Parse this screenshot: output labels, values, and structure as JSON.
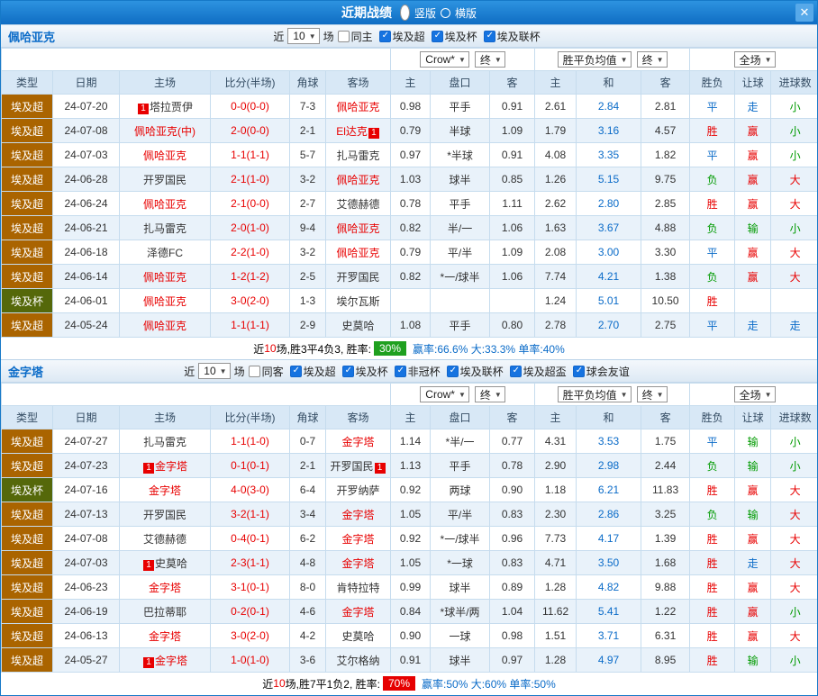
{
  "title_bar": {
    "title": "近期战绩",
    "vertical_label": "竖版",
    "horizontal_label": "横版",
    "close_label": "✕"
  },
  "filter_labels": {
    "near": "近",
    "games": "场"
  },
  "selects": {
    "bookmaker": "Crow*",
    "book_state": "终",
    "odds_mode": "胜平负均值",
    "odds_state": "终",
    "scope": "全场"
  },
  "table_columns": {
    "type": "类型",
    "date": "日期",
    "home": "主场",
    "score": "比分(半场)",
    "corner": "角球",
    "away": "客场",
    "asia_home": "主",
    "asia_handicap": "盘口",
    "asia_away": "客",
    "euro_home": "主",
    "euro_draw": "和",
    "euro_away": "客",
    "result": "胜负",
    "handicap": "让球",
    "goals": "进球数"
  },
  "colors": {
    "league_super_bg": "#aa6400",
    "league_cup_bg": "#55680a",
    "accent_red": "#e80000",
    "accent_green": "#009a00",
    "accent_blue": "#0a6bc8",
    "win_badge_green": "#1fa01f",
    "win_badge_red": "#e60000"
  },
  "sections": [
    {
      "team": "佩哈亚克",
      "near": "10",
      "filters": [
        {
          "label": "同主",
          "checked": false
        },
        {
          "label": "埃及超",
          "checked": true
        },
        {
          "label": "埃及杯",
          "checked": true
        },
        {
          "label": "埃及联杯",
          "checked": true
        }
      ],
      "rows": [
        {
          "lg": "埃及超",
          "cup": false,
          "date": "24-07-20",
          "h": "塔拉贾伊",
          "hr": false,
          "hb": "1",
          "hbp": "l",
          "a": "佩哈亚克",
          "ar": true,
          "s": "0-0(0-0)",
          "c": "7-3",
          "o1": "0.98",
          "o2": "平手",
          "o3": "0.91",
          "e1": "2.61",
          "e2": "2.84",
          "e3": "2.81",
          "w": "平",
          "wc": "b",
          "hd": "走",
          "hdc": "b",
          "g": "小",
          "gc": "g"
        },
        {
          "lg": "埃及超",
          "cup": false,
          "date": "24-07-08",
          "h": "佩哈亚克(中)",
          "hr": true,
          "a": "El达克",
          "ar": true,
          "ab": "1",
          "abp": "r",
          "s": "2-0(0-0)",
          "c": "2-1",
          "o1": "0.79",
          "o2": "半球",
          "o3": "1.09",
          "e1": "1.79",
          "e2": "3.16",
          "e3": "4.57",
          "w": "胜",
          "wc": "r",
          "hd": "赢",
          "hdc": "r",
          "g": "小",
          "gc": "g"
        },
        {
          "lg": "埃及超",
          "cup": false,
          "date": "24-07-03",
          "h": "佩哈亚克",
          "hr": true,
          "a": "扎马雷克",
          "ar": false,
          "s": "1-1(1-1)",
          "c": "5-7",
          "o1": "0.97",
          "o2": "*半球",
          "o3": "0.91",
          "e1": "4.08",
          "e2": "3.35",
          "e3": "1.82",
          "w": "平",
          "wc": "b",
          "hd": "赢",
          "hdc": "r",
          "g": "小",
          "gc": "g"
        },
        {
          "lg": "埃及超",
          "cup": false,
          "date": "24-06-28",
          "h": "开罗国民",
          "hr": false,
          "a": "佩哈亚克",
          "ar": true,
          "s": "2-1(1-0)",
          "c": "3-2",
          "o1": "1.03",
          "o2": "球半",
          "o3": "0.85",
          "e1": "1.26",
          "e2": "5.15",
          "e3": "9.75",
          "w": "负",
          "wc": "g",
          "hd": "赢",
          "hdc": "r",
          "g": "大",
          "gc": "r"
        },
        {
          "lg": "埃及超",
          "cup": false,
          "date": "24-06-24",
          "h": "佩哈亚克",
          "hr": true,
          "a": "艾德赫德",
          "ar": false,
          "s": "2-1(0-0)",
          "c": "2-7",
          "o1": "0.78",
          "o2": "平手",
          "o3": "1.11",
          "e1": "2.62",
          "e2": "2.80",
          "e3": "2.85",
          "w": "胜",
          "wc": "r",
          "hd": "赢",
          "hdc": "r",
          "g": "大",
          "gc": "r"
        },
        {
          "lg": "埃及超",
          "cup": false,
          "date": "24-06-21",
          "h": "扎马雷克",
          "hr": false,
          "a": "佩哈亚克",
          "ar": true,
          "s": "2-0(1-0)",
          "c": "9-4",
          "o1": "0.82",
          "o2": "半/一",
          "o3": "1.06",
          "e1": "1.63",
          "e2": "3.67",
          "e3": "4.88",
          "w": "负",
          "wc": "g",
          "hd": "输",
          "hdc": "g",
          "g": "小",
          "gc": "g"
        },
        {
          "lg": "埃及超",
          "cup": false,
          "date": "24-06-18",
          "h": "泽德FC",
          "hr": false,
          "a": "佩哈亚克",
          "ar": true,
          "s": "2-2(1-0)",
          "c": "3-2",
          "o1": "0.79",
          "o2": "平/半",
          "o3": "1.09",
          "e1": "2.08",
          "e2": "3.00",
          "e3": "3.30",
          "w": "平",
          "wc": "b",
          "hd": "赢",
          "hdc": "r",
          "g": "大",
          "gc": "r"
        },
        {
          "lg": "埃及超",
          "cup": false,
          "date": "24-06-14",
          "h": "佩哈亚克",
          "hr": true,
          "a": "开罗国民",
          "ar": false,
          "s": "1-2(1-2)",
          "c": "2-5",
          "o1": "0.82",
          "o2": "*一/球半",
          "o3": "1.06",
          "e1": "7.74",
          "e2": "4.21",
          "e3": "1.38",
          "w": "负",
          "wc": "g",
          "hd": "赢",
          "hdc": "r",
          "g": "大",
          "gc": "r"
        },
        {
          "lg": "埃及杯",
          "cup": true,
          "date": "24-06-01",
          "h": "佩哈亚克",
          "hr": true,
          "a": "埃尔瓦斯",
          "ar": false,
          "s": "3-0(2-0)",
          "c": "1-3",
          "o1": "",
          "o2": "",
          "o3": "",
          "e1": "1.24",
          "e2": "5.01",
          "e3": "10.50",
          "w": "胜",
          "wc": "r",
          "hd": "",
          "hdc": "",
          "g": "",
          "gc": ""
        },
        {
          "lg": "埃及超",
          "cup": false,
          "date": "24-05-24",
          "h": "佩哈亚克",
          "hr": true,
          "a": "史莫哈",
          "ar": false,
          "s": "1-1(1-1)",
          "c": "2-9",
          "o1": "1.08",
          "o2": "平手",
          "o3": "0.80",
          "e1": "2.78",
          "e2": "2.70",
          "e3": "2.75",
          "w": "平",
          "wc": "b",
          "hd": "走",
          "hdc": "b",
          "g": "走",
          "gc": "b"
        }
      ],
      "summary": {
        "pre": "近",
        "count": "10",
        "rest": "场,胜3平4负3, 胜率:",
        "pct": "30%",
        "pct_color": "#1fa01f",
        "stats": "赢率:66.6% 大:33.3% 单率:40%"
      }
    },
    {
      "team": "金字塔",
      "near": "10",
      "filters": [
        {
          "label": "同客",
          "checked": false
        },
        {
          "label": "埃及超",
          "checked": true
        },
        {
          "label": "埃及杯",
          "checked": true
        },
        {
          "label": "非冠杯",
          "checked": true
        },
        {
          "label": "埃及联杯",
          "checked": true
        },
        {
          "label": "埃及超盃",
          "checked": true
        },
        {
          "label": "球会友谊",
          "checked": true
        }
      ],
      "rows": [
        {
          "lg": "埃及超",
          "cup": false,
          "date": "24-07-27",
          "h": "扎马雷克",
          "hr": false,
          "a": "金字塔",
          "ar": true,
          "s": "1-1(1-0)",
          "c": "0-7",
          "o1": "1.14",
          "o2": "*半/一",
          "o3": "0.77",
          "e1": "4.31",
          "e2": "3.53",
          "e3": "1.75",
          "w": "平",
          "wc": "b",
          "hd": "输",
          "hdc": "g",
          "g": "小",
          "gc": "g"
        },
        {
          "lg": "埃及超",
          "cup": false,
          "date": "24-07-23",
          "h": "金字塔",
          "hr": true,
          "hb": "1",
          "hbp": "l",
          "a": "开罗国民",
          "ar": false,
          "ab": "1",
          "abp": "r",
          "s": "0-1(0-1)",
          "c": "2-1",
          "o1": "1.13",
          "o2": "平手",
          "o3": "0.78",
          "e1": "2.90",
          "e2": "2.98",
          "e3": "2.44",
          "w": "负",
          "wc": "g",
          "hd": "输",
          "hdc": "g",
          "g": "小",
          "gc": "g"
        },
        {
          "lg": "埃及杯",
          "cup": true,
          "date": "24-07-16",
          "h": "金字塔",
          "hr": true,
          "a": "开罗纳萨",
          "ar": false,
          "s": "4-0(3-0)",
          "c": "6-4",
          "o1": "0.92",
          "o2": "两球",
          "o3": "0.90",
          "e1": "1.18",
          "e2": "6.21",
          "e3": "11.83",
          "w": "胜",
          "wc": "r",
          "hd": "赢",
          "hdc": "r",
          "g": "大",
          "gc": "r"
        },
        {
          "lg": "埃及超",
          "cup": false,
          "date": "24-07-13",
          "h": "开罗国民",
          "hr": false,
          "a": "金字塔",
          "ar": true,
          "s": "3-2(1-1)",
          "c": "3-4",
          "o1": "1.05",
          "o2": "平/半",
          "o3": "0.83",
          "e1": "2.30",
          "e2": "2.86",
          "e3": "3.25",
          "w": "负",
          "wc": "g",
          "hd": "输",
          "hdc": "g",
          "g": "大",
          "gc": "r"
        },
        {
          "lg": "埃及超",
          "cup": false,
          "date": "24-07-08",
          "h": "艾德赫德",
          "hr": false,
          "a": "金字塔",
          "ar": true,
          "s": "0-4(0-1)",
          "c": "6-2",
          "o1": "0.92",
          "o2": "*一/球半",
          "o3": "0.96",
          "e1": "7.73",
          "e2": "4.17",
          "e3": "1.39",
          "w": "胜",
          "wc": "r",
          "hd": "赢",
          "hdc": "r",
          "g": "大",
          "gc": "r"
        },
        {
          "lg": "埃及超",
          "cup": false,
          "date": "24-07-03",
          "h": "史莫哈",
          "hr": false,
          "hb": "1",
          "hbp": "l",
          "a": "金字塔",
          "ar": true,
          "s": "2-3(1-1)",
          "c": "4-8",
          "o1": "1.05",
          "o2": "*一球",
          "o3": "0.83",
          "e1": "4.71",
          "e2": "3.50",
          "e3": "1.68",
          "w": "胜",
          "wc": "r",
          "hd": "走",
          "hdc": "b",
          "g": "大",
          "gc": "r"
        },
        {
          "lg": "埃及超",
          "cup": false,
          "date": "24-06-23",
          "h": "金字塔",
          "hr": true,
          "a": "肯特拉特",
          "ar": false,
          "s": "3-1(0-1)",
          "c": "8-0",
          "o1": "0.99",
          "o2": "球半",
          "o3": "0.89",
          "e1": "1.28",
          "e2": "4.82",
          "e3": "9.88",
          "w": "胜",
          "wc": "r",
          "hd": "赢",
          "hdc": "r",
          "g": "大",
          "gc": "r"
        },
        {
          "lg": "埃及超",
          "cup": false,
          "date": "24-06-19",
          "h": "巴拉蒂耶",
          "hr": false,
          "a": "金字塔",
          "ar": true,
          "s": "0-2(0-1)",
          "c": "4-6",
          "o1": "0.84",
          "o2": "*球半/两",
          "o3": "1.04",
          "e1": "11.62",
          "e2": "5.41",
          "e3": "1.22",
          "w": "胜",
          "wc": "r",
          "hd": "赢",
          "hdc": "r",
          "g": "小",
          "gc": "g"
        },
        {
          "lg": "埃及超",
          "cup": false,
          "date": "24-06-13",
          "h": "金字塔",
          "hr": true,
          "a": "史莫哈",
          "ar": false,
          "s": "3-0(2-0)",
          "c": "4-2",
          "o1": "0.90",
          "o2": "一球",
          "o3": "0.98",
          "e1": "1.51",
          "e2": "3.71",
          "e3": "6.31",
          "w": "胜",
          "wc": "r",
          "hd": "赢",
          "hdc": "r",
          "g": "大",
          "gc": "r"
        },
        {
          "lg": "埃及超",
          "cup": false,
          "date": "24-05-27",
          "h": "金字塔",
          "hr": true,
          "hb": "1",
          "hbp": "l",
          "a": "艾尔格纳",
          "ar": false,
          "s": "1-0(1-0)",
          "c": "3-6",
          "o1": "0.91",
          "o2": "球半",
          "o3": "0.97",
          "e1": "1.28",
          "e2": "4.97",
          "e3": "8.95",
          "w": "胜",
          "wc": "r",
          "hd": "输",
          "hdc": "g",
          "g": "小",
          "gc": "g"
        }
      ],
      "summary": {
        "pre": "近",
        "count": "10",
        "rest": "场,胜7平1负2, 胜率:",
        "pct": "70%",
        "pct_color": "#e60000",
        "stats": "赢率:50% 大:60% 单率:50%"
      }
    }
  ]
}
